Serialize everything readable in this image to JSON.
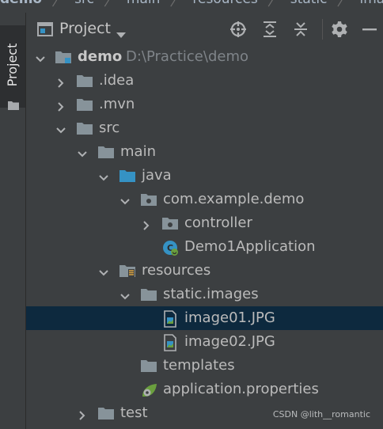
{
  "breadcrumb": {
    "items": [
      "demo",
      "src",
      "main",
      "resources",
      "static",
      "images"
    ]
  },
  "stripe": {
    "tab_label": "Project",
    "tab_icon": "folder-icon"
  },
  "header": {
    "title": "Project",
    "dropdown_icon": "caret-down-icon",
    "tools": [
      {
        "name": "locate-icon"
      },
      {
        "name": "expand-all-icon"
      },
      {
        "name": "collapse-all-icon"
      },
      {
        "name": "gear-icon"
      },
      {
        "name": "minimize-icon"
      }
    ]
  },
  "tree": {
    "root": {
      "label": "demo",
      "path": "D:\\Practice\\demo"
    },
    "items": [
      {
        "label": ".idea"
      },
      {
        "label": ".mvn"
      },
      {
        "label": "src"
      },
      {
        "label": "main"
      },
      {
        "label": "java"
      },
      {
        "label": "com.example.demo"
      },
      {
        "label": "controller"
      },
      {
        "label": "Demo1Application"
      },
      {
        "label": "resources"
      },
      {
        "label": "static.images"
      },
      {
        "label": "image01.JPG"
      },
      {
        "label": "image02.JPG"
      },
      {
        "label": "templates"
      },
      {
        "label": "application.properties"
      },
      {
        "label": "test"
      }
    ],
    "selected": "image01.JPG"
  },
  "watermark": "CSDN @lith__romantic",
  "colors": {
    "background": "#3c3f41",
    "selection": "#0d293e",
    "folder": "#87939a",
    "source_folder": "#3592c4",
    "text": "#bbbbbb",
    "path_text": "#7f8489"
  }
}
